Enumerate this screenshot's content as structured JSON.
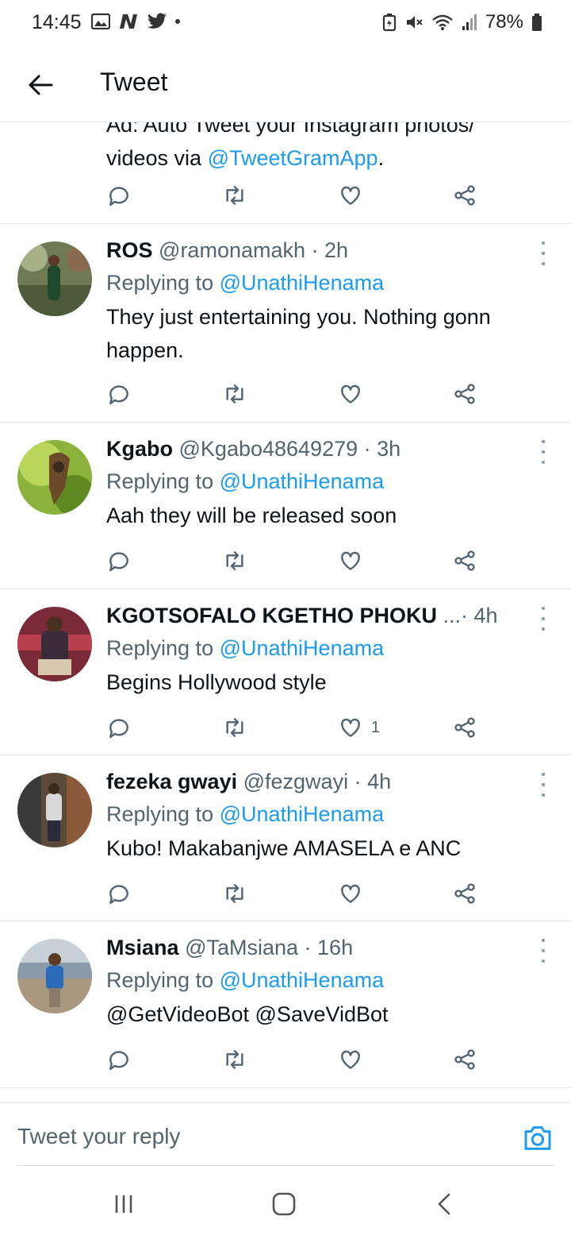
{
  "status_bar": {
    "time": "14:45",
    "battery": "78%",
    "left_icons": [
      "gallery-icon",
      "n-app-icon",
      "twitter-bird-icon"
    ],
    "right_icons": [
      "battery-saver-icon",
      "mute-icon",
      "wifi-icon",
      "signal-icon",
      "battery-icon"
    ]
  },
  "header": {
    "title": "Tweet"
  },
  "partial_tweet": {
    "text_line1": "Ad: Auto Tweet your Instagram photos/",
    "text_line2_prefix": "videos via ",
    "text_line2_link": "@TweetGramApp",
    "text_line2_suffix": "."
  },
  "tweets": [
    {
      "name": "ROS",
      "handle": "@ramonamakh",
      "time": "· 2h",
      "replying_prefix": "Replying to ",
      "replying_to": "@UnathiHenama",
      "text": "They just entertaining you. Nothing gonn happen.",
      "like_count": ""
    },
    {
      "name": "Kgabo",
      "handle": "@Kgabo48649279",
      "time": "· 3h",
      "replying_prefix": "Replying to ",
      "replying_to": "@UnathiHenama",
      "text": "Aah they will be released soon",
      "like_count": ""
    },
    {
      "name": "KGOTSOFALO KGETHO PHOKU",
      "handle": "...",
      "time": "· 4h",
      "replying_prefix": "Replying to ",
      "replying_to": "@UnathiHenama",
      "text": "Begins Hollywood style",
      "like_count": "1"
    },
    {
      "name": "fezeka gwayi",
      "handle": "@fezgwayi",
      "time": "· 4h",
      "replying_prefix": "Replying to ",
      "replying_to": "@UnathiHenama",
      "text": "Kubo! Makabanjwe AMASELA e ANC",
      "like_count": ""
    },
    {
      "name": "Msiana",
      "handle": "@TaMsiana",
      "time": "· 16h",
      "replying_prefix": "Replying to ",
      "replying_to": "@UnathiHenama",
      "text": "@GetVideoBot @SaveVidBot",
      "like_count": ""
    }
  ],
  "reply_bar": {
    "placeholder": "Tweet your reply"
  },
  "colors": {
    "link": "#1d9bf0",
    "secondary_text": "#536471",
    "primary_text": "#0f1419",
    "divider": "#e1e8ed"
  }
}
